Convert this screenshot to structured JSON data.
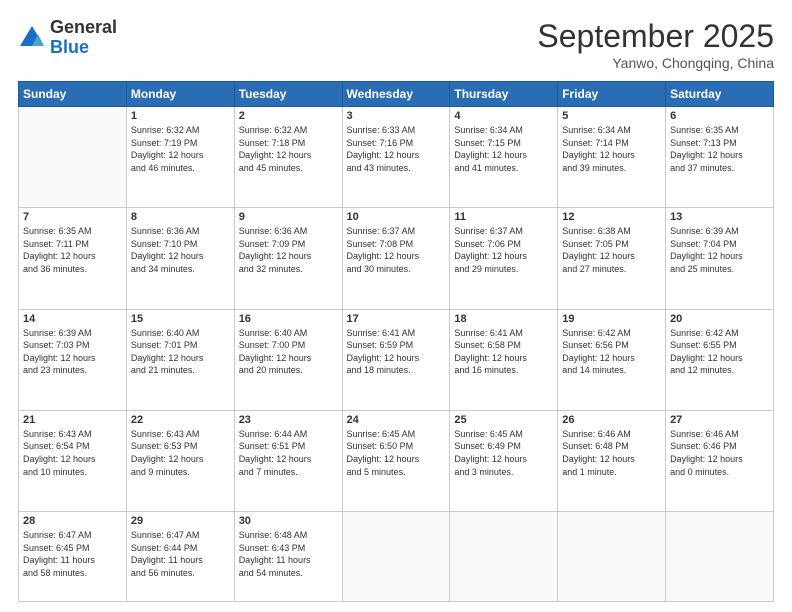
{
  "logo": {
    "general": "General",
    "blue": "Blue"
  },
  "title": "September 2025",
  "location": "Yanwo, Chongqing, China",
  "days_of_week": [
    "Sunday",
    "Monday",
    "Tuesday",
    "Wednesday",
    "Thursday",
    "Friday",
    "Saturday"
  ],
  "weeks": [
    [
      {
        "day": "",
        "info": ""
      },
      {
        "day": "1",
        "info": "Sunrise: 6:32 AM\nSunset: 7:19 PM\nDaylight: 12 hours\nand 46 minutes."
      },
      {
        "day": "2",
        "info": "Sunrise: 6:32 AM\nSunset: 7:18 PM\nDaylight: 12 hours\nand 45 minutes."
      },
      {
        "day": "3",
        "info": "Sunrise: 6:33 AM\nSunset: 7:16 PM\nDaylight: 12 hours\nand 43 minutes."
      },
      {
        "day": "4",
        "info": "Sunrise: 6:34 AM\nSunset: 7:15 PM\nDaylight: 12 hours\nand 41 minutes."
      },
      {
        "day": "5",
        "info": "Sunrise: 6:34 AM\nSunset: 7:14 PM\nDaylight: 12 hours\nand 39 minutes."
      },
      {
        "day": "6",
        "info": "Sunrise: 6:35 AM\nSunset: 7:13 PM\nDaylight: 12 hours\nand 37 minutes."
      }
    ],
    [
      {
        "day": "7",
        "info": "Sunrise: 6:35 AM\nSunset: 7:11 PM\nDaylight: 12 hours\nand 36 minutes."
      },
      {
        "day": "8",
        "info": "Sunrise: 6:36 AM\nSunset: 7:10 PM\nDaylight: 12 hours\nand 34 minutes."
      },
      {
        "day": "9",
        "info": "Sunrise: 6:36 AM\nSunset: 7:09 PM\nDaylight: 12 hours\nand 32 minutes."
      },
      {
        "day": "10",
        "info": "Sunrise: 6:37 AM\nSunset: 7:08 PM\nDaylight: 12 hours\nand 30 minutes."
      },
      {
        "day": "11",
        "info": "Sunrise: 6:37 AM\nSunset: 7:06 PM\nDaylight: 12 hours\nand 29 minutes."
      },
      {
        "day": "12",
        "info": "Sunrise: 6:38 AM\nSunset: 7:05 PM\nDaylight: 12 hours\nand 27 minutes."
      },
      {
        "day": "13",
        "info": "Sunrise: 6:39 AM\nSunset: 7:04 PM\nDaylight: 12 hours\nand 25 minutes."
      }
    ],
    [
      {
        "day": "14",
        "info": "Sunrise: 6:39 AM\nSunset: 7:03 PM\nDaylight: 12 hours\nand 23 minutes."
      },
      {
        "day": "15",
        "info": "Sunrise: 6:40 AM\nSunset: 7:01 PM\nDaylight: 12 hours\nand 21 minutes."
      },
      {
        "day": "16",
        "info": "Sunrise: 6:40 AM\nSunset: 7:00 PM\nDaylight: 12 hours\nand 20 minutes."
      },
      {
        "day": "17",
        "info": "Sunrise: 6:41 AM\nSunset: 6:59 PM\nDaylight: 12 hours\nand 18 minutes."
      },
      {
        "day": "18",
        "info": "Sunrise: 6:41 AM\nSunset: 6:58 PM\nDaylight: 12 hours\nand 16 minutes."
      },
      {
        "day": "19",
        "info": "Sunrise: 6:42 AM\nSunset: 6:56 PM\nDaylight: 12 hours\nand 14 minutes."
      },
      {
        "day": "20",
        "info": "Sunrise: 6:42 AM\nSunset: 6:55 PM\nDaylight: 12 hours\nand 12 minutes."
      }
    ],
    [
      {
        "day": "21",
        "info": "Sunrise: 6:43 AM\nSunset: 6:54 PM\nDaylight: 12 hours\nand 10 minutes."
      },
      {
        "day": "22",
        "info": "Sunrise: 6:43 AM\nSunset: 6:53 PM\nDaylight: 12 hours\nand 9 minutes."
      },
      {
        "day": "23",
        "info": "Sunrise: 6:44 AM\nSunset: 6:51 PM\nDaylight: 12 hours\nand 7 minutes."
      },
      {
        "day": "24",
        "info": "Sunrise: 6:45 AM\nSunset: 6:50 PM\nDaylight: 12 hours\nand 5 minutes."
      },
      {
        "day": "25",
        "info": "Sunrise: 6:45 AM\nSunset: 6:49 PM\nDaylight: 12 hours\nand 3 minutes."
      },
      {
        "day": "26",
        "info": "Sunrise: 6:46 AM\nSunset: 6:48 PM\nDaylight: 12 hours\nand 1 minute."
      },
      {
        "day": "27",
        "info": "Sunrise: 6:46 AM\nSunset: 6:46 PM\nDaylight: 12 hours\nand 0 minutes."
      }
    ],
    [
      {
        "day": "28",
        "info": "Sunrise: 6:47 AM\nSunset: 6:45 PM\nDaylight: 11 hours\nand 58 minutes."
      },
      {
        "day": "29",
        "info": "Sunrise: 6:47 AM\nSunset: 6:44 PM\nDaylight: 11 hours\nand 56 minutes."
      },
      {
        "day": "30",
        "info": "Sunrise: 6:48 AM\nSunset: 6:43 PM\nDaylight: 11 hours\nand 54 minutes."
      },
      {
        "day": "",
        "info": ""
      },
      {
        "day": "",
        "info": ""
      },
      {
        "day": "",
        "info": ""
      },
      {
        "day": "",
        "info": ""
      }
    ]
  ]
}
